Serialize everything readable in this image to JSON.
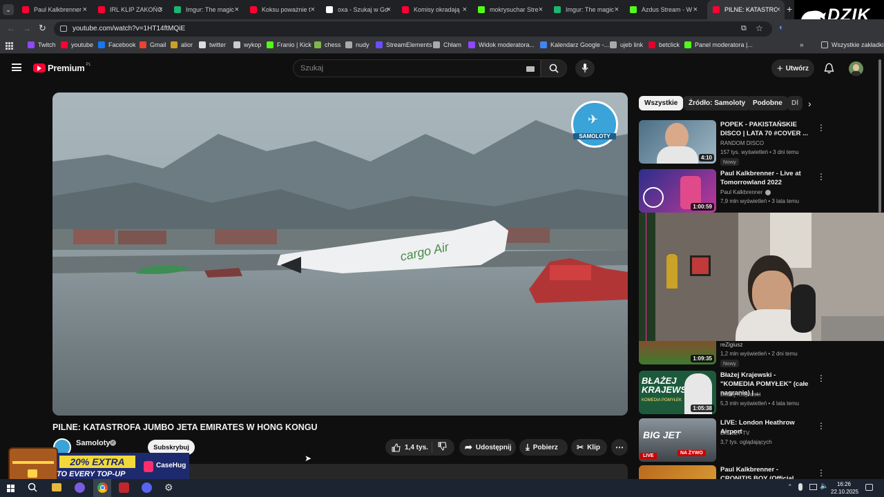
{
  "browser": {
    "tabs": [
      {
        "label": "Paul Kalkbrenner",
        "color": "#ff0033"
      },
      {
        "label": "IRL KLIP ZAKOŃC",
        "color": "#ff0033"
      },
      {
        "label": "Imgur: The magic",
        "color": "#1bb76e"
      },
      {
        "label": "Koksu poważnie t",
        "color": "#ff0033"
      },
      {
        "label": "oxa - Szukaj w Go",
        "color": "#ffffff"
      },
      {
        "label": "Komisy okradają",
        "color": "#ff0033"
      },
      {
        "label": "mokrysuchar Stre",
        "color": "#53fc18"
      },
      {
        "label": "Imgur: The magic",
        "color": "#1bb76e"
      },
      {
        "label": "Azdus Stream - W",
        "color": "#53fc18"
      },
      {
        "label": "PILNE: KATASTRO",
        "color": "#ff0033"
      }
    ],
    "url": "youtube.com/watch?v=1HT14ftMQiE",
    "bookmarks": [
      {
        "label": "Twitch",
        "color": "#9146ff"
      },
      {
        "label": "youtube",
        "color": "#ff0033"
      },
      {
        "label": "Facebook",
        "color": "#1877f2"
      },
      {
        "label": "Gmail",
        "color": "#ea4335"
      },
      {
        "label": "alior",
        "color": "#c9a227"
      },
      {
        "label": "twitter",
        "color": "#dddddd"
      },
      {
        "label": "wykop",
        "color": "#cccccc"
      },
      {
        "label": "Franio | Kick",
        "color": "#53fc18"
      },
      {
        "label": "chess",
        "color": "#81b64c"
      },
      {
        "label": "nudy",
        "color": "#aaaaaa"
      },
      {
        "label": "StreamElements",
        "color": "#6c4cff"
      },
      {
        "label": "Chłam",
        "color": "#aaaaaa"
      },
      {
        "label": "Widok moderatora...",
        "color": "#9146ff"
      },
      {
        "label": "Kalendarz Google -...",
        "color": "#4285f4"
      },
      {
        "label": "ujeb link",
        "color": "#aaaaaa"
      },
      {
        "label": "betclick",
        "color": "#e4002b"
      },
      {
        "label": "Panel moderatora |...",
        "color": "#53fc18"
      }
    ],
    "all_bookmarks": "Wszystkie zakładki",
    "overlay_logo": "DZIK"
  },
  "youtube": {
    "logo": "Premium",
    "logo_region": "PL",
    "search_placeholder": "Szukaj",
    "create_label": "Utwórz",
    "chips": [
      "Wszystkie",
      "Źródło: Samoloty",
      "Podobne",
      "Dl"
    ],
    "video": {
      "title": "PILNE: KATASTROFA JUMBO JETA EMIRATES W HONG KONGU",
      "channel": "Samoloty",
      "channel_logo_text": "SAMOLOTY",
      "subscribe": "Subskrybuj",
      "likes": "1,4 tys.",
      "share": "Udostępnij",
      "download": "Pobierz",
      "clip": "Klip",
      "scene_text": "cargo Air"
    },
    "recommendations": [
      {
        "title": "POPEK - PAKISTAŃSKIE DISCO | LATA 70 #COVER ...",
        "channel": "RANDOM DISCO",
        "meta": "157 tys. wyświetleń • 3 dni temu",
        "duration": "4:10",
        "badge": "Nowy"
      },
      {
        "title": "Paul Kalkbrenner - Live at Tomorrowland 2022",
        "channel": "Paul Kalkbrenner",
        "meta": "7,9 mln wyświetleń • 3 lata temu",
        "duration": "1:00:59",
        "badge": ""
      },
      {
        "title": "",
        "channel": "reZigiusz",
        "meta": "1,2 mln wyświetleń • 2 dni temu",
        "duration": "1:09:35",
        "badge": "Nowy"
      },
      {
        "title": "Błażej Krajewski - \"KOMEDIA POMYŁEK\" (całe nagranie) | ...",
        "channel": "Błażej Krajewski",
        "meta": "5,3 mln wyświetleń • 4 lata temu",
        "duration": "1:05:38",
        "badge": ""
      },
      {
        "title": "LIVE: London Heathrow Airport",
        "channel": "BIG JET TV",
        "meta": "3,7 tys. oglądających",
        "duration": "",
        "badge": "NA ŻYWO"
      },
      {
        "title": "Paul Kalkbrenner - CRONITIS BOY (Official Visualizer)",
        "channel": "",
        "meta": "",
        "duration": "",
        "badge": ""
      }
    ],
    "thumb_texts": {
      "blazej": "BŁAŻEJ KRAJEWSKI",
      "blazej_sub": "KOMEDIA POMYŁEK",
      "bigjet": "BIG JET",
      "live": "LIVE"
    }
  },
  "ad": {
    "line1": "20% EXTRA",
    "line2": "TO EVERY TOP-UP",
    "brand": "CaseHug"
  },
  "taskbar": {
    "time": "16:26",
    "date": "22.10.2025"
  }
}
